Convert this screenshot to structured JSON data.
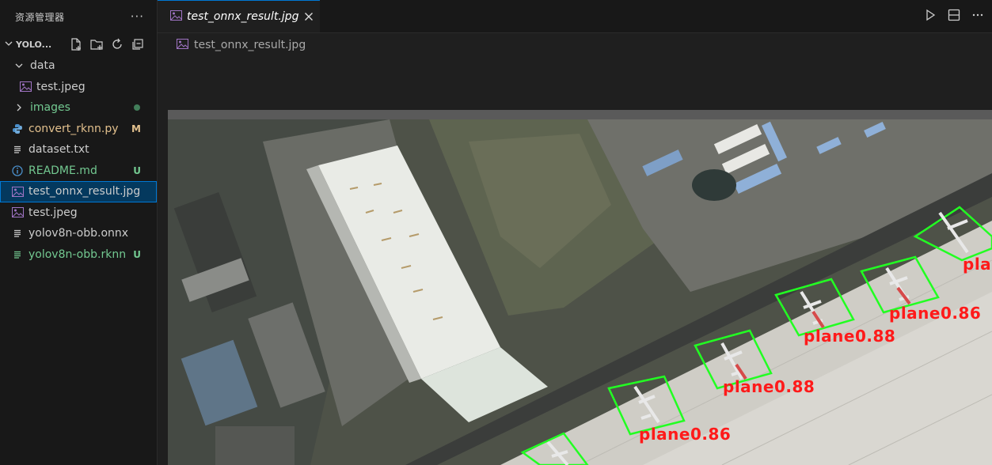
{
  "sidebar": {
    "title": "资源管理器",
    "more": "···",
    "project": "YOLO...",
    "items": [
      {
        "label": "data",
        "kind": "folder-open",
        "color": "norm"
      },
      {
        "label": "test.jpeg",
        "kind": "image",
        "color": "norm"
      },
      {
        "label": "images",
        "kind": "folder",
        "color": "green",
        "dot": true
      },
      {
        "label": "convert_rknn.py",
        "kind": "python",
        "color": "mod",
        "badge": "M"
      },
      {
        "label": "dataset.txt",
        "kind": "text",
        "color": "norm"
      },
      {
        "label": "README.md",
        "kind": "info",
        "color": "green",
        "badge": "U"
      },
      {
        "label": "test_onnx_result.jpg",
        "kind": "image",
        "color": "norm",
        "selected": true
      },
      {
        "label": "test.jpeg",
        "kind": "image",
        "color": "norm"
      },
      {
        "label": "yolov8n-obb.onnx",
        "kind": "text",
        "color": "norm"
      },
      {
        "label": "yolov8n-obb.rknn",
        "kind": "text",
        "color": "green",
        "badge": "U"
      }
    ]
  },
  "editor": {
    "tab_label": "test_onnx_result.jpg",
    "breadcrumb": "test_onnx_result.jpg"
  },
  "detections": [
    {
      "label": "plane0.86"
    },
    {
      "label": "plane0.88"
    },
    {
      "label": "plane0.88"
    },
    {
      "label": "plane0.86"
    },
    {
      "label": "plane"
    }
  ],
  "colors": {
    "accent": "#0078d4",
    "detection_box": "#22ff22",
    "detection_label": "#ff1a1a"
  }
}
